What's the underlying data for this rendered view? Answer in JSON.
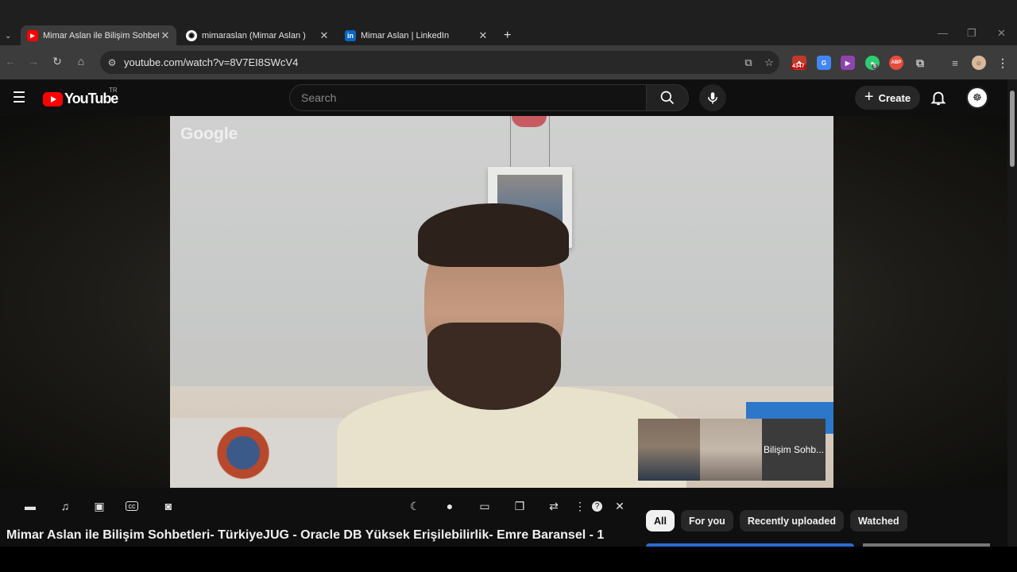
{
  "browser": {
    "tabs": [
      {
        "title": "Mimar Aslan ile Bilişim Sohbetl",
        "favicon": "youtube-icon",
        "active": true
      },
      {
        "title": "mimaraslan (Mimar Aslan )",
        "favicon": "github-icon",
        "active": false
      },
      {
        "title": "Mimar Aslan | LinkedIn",
        "favicon": "linkedin-icon",
        "active": false
      }
    ],
    "url": "youtube.com/watch?v=8V7EI8SWcV4",
    "extensions": [
      {
        "name": "ublock-icon",
        "badge": "4347",
        "color": "#c0392b"
      },
      {
        "name": "translate-icon",
        "badge": "",
        "color": "#4285f4"
      },
      {
        "name": "video-speed-icon",
        "badge": "",
        "color": "#8e44ad"
      },
      {
        "name": "chat-extension-icon",
        "badge": "5",
        "color": "#2ecc71"
      },
      {
        "name": "adblock-plus-icon",
        "badge": "",
        "color": "#e74c3c",
        "label": "ABP"
      }
    ]
  },
  "youtube": {
    "logo_text": "YouTube",
    "country_code": "TR",
    "search_placeholder": "Search",
    "create_label": "Create"
  },
  "video": {
    "watermark": "Google",
    "participant_tile_label": "Bilişim Sohb...",
    "title": "Mimar Aslan ile Bilişim Sohbetleri- TürkiyeJUG - Oracle DB Yüksek Erişilebilirlik- Emre Baransel - 1"
  },
  "chips": [
    "All",
    "For you",
    "Recently uploaded",
    "Watched"
  ],
  "colors": {
    "accent": "#ff0000",
    "background": "#0f0f0f",
    "chip": "#272727"
  }
}
